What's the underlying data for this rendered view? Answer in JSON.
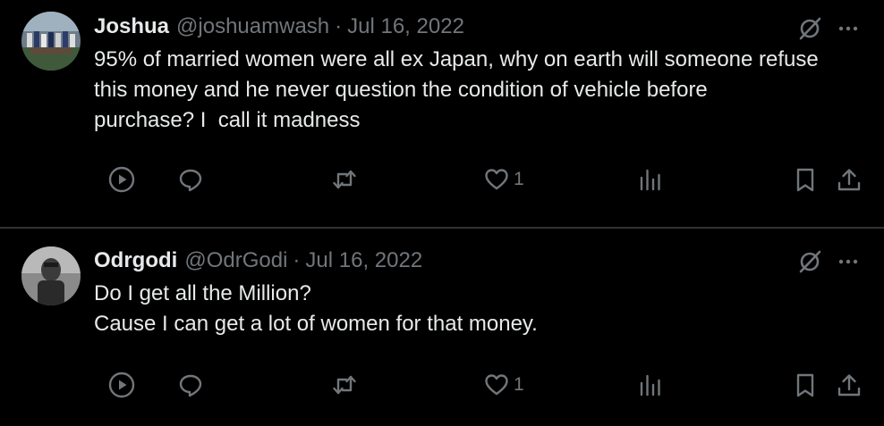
{
  "tweets": [
    {
      "author": {
        "name": "Joshua",
        "handle": "@joshuamwash"
      },
      "separator": "·",
      "date": "Jul 16, 2022",
      "text_lines": [
        "95% of married women were all ex Japan, why on earth will someone refuse",
        "this money and he never question the condition of vehicle before",
        "purchase? I  call it madness"
      ],
      "likes": "1"
    },
    {
      "author": {
        "name": "Odrgodi",
        "handle": "@OdrGodi"
      },
      "separator": "·",
      "date": "Jul 16, 2022",
      "text_lines": [
        "Do I get all the Million?",
        "Cause I can get a lot of women for that money."
      ],
      "likes": "1"
    }
  ],
  "icons": {
    "play": "play-circle-icon",
    "reply": "reply-bubble-icon",
    "retweet": "retweet-icon",
    "like": "heart-icon",
    "views": "views-bar-chart-icon",
    "bookmark": "bookmark-icon",
    "share": "share-upload-icon",
    "grok": "grok-slash-circle-icon",
    "more": "more-dots-icon"
  },
  "colors": {
    "background": "#000000",
    "text": "#e7e9ea",
    "muted": "#71767b",
    "divider": "#2f3336"
  }
}
